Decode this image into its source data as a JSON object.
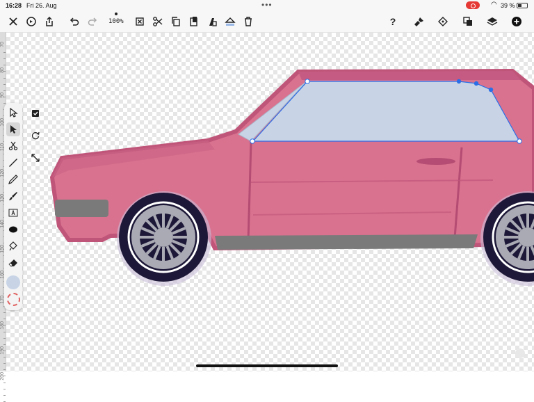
{
  "status_bar": {
    "time": "16:28",
    "date": "Fri 26. Aug",
    "battery": "39 %"
  },
  "toolbar": {
    "zoom": "100%",
    "left_icons": [
      "close-icon",
      "settings-icon",
      "share-icon",
      "undo-icon",
      "redo-icon",
      "deselect-icon",
      "cut-icon",
      "copy-icon",
      "paste-icon",
      "duplicate-icon",
      "fill-icon",
      "trash-icon"
    ],
    "right_icons": [
      "help-icon",
      "brush-settings-icon",
      "node-icon",
      "arrange-icon",
      "layers-icon",
      "add-icon"
    ],
    "help_label": "?"
  },
  "ruler": {
    "labels": [
      "70",
      "80",
      "90",
      "100",
      "110",
      "120",
      "130",
      "140",
      "150",
      "160",
      "170",
      "180",
      "190",
      "200"
    ]
  },
  "tools": [
    "move-tool",
    "node-tool",
    "cut-tool",
    "pen-tool",
    "pencil-tool",
    "brush-tool",
    "text-tool",
    "shape-tool",
    "fill-tool",
    "eraser-tool"
  ],
  "colors": {
    "accent": "#2a6ee8",
    "car_body": "#d9728f",
    "car_outline": "#c0557a",
    "window": "#c8d4e6",
    "tire": "#1e1838",
    "rim": "#a9aab4",
    "bumper": "#7a7a7a",
    "fill_swatch": "#c8d4e6"
  }
}
